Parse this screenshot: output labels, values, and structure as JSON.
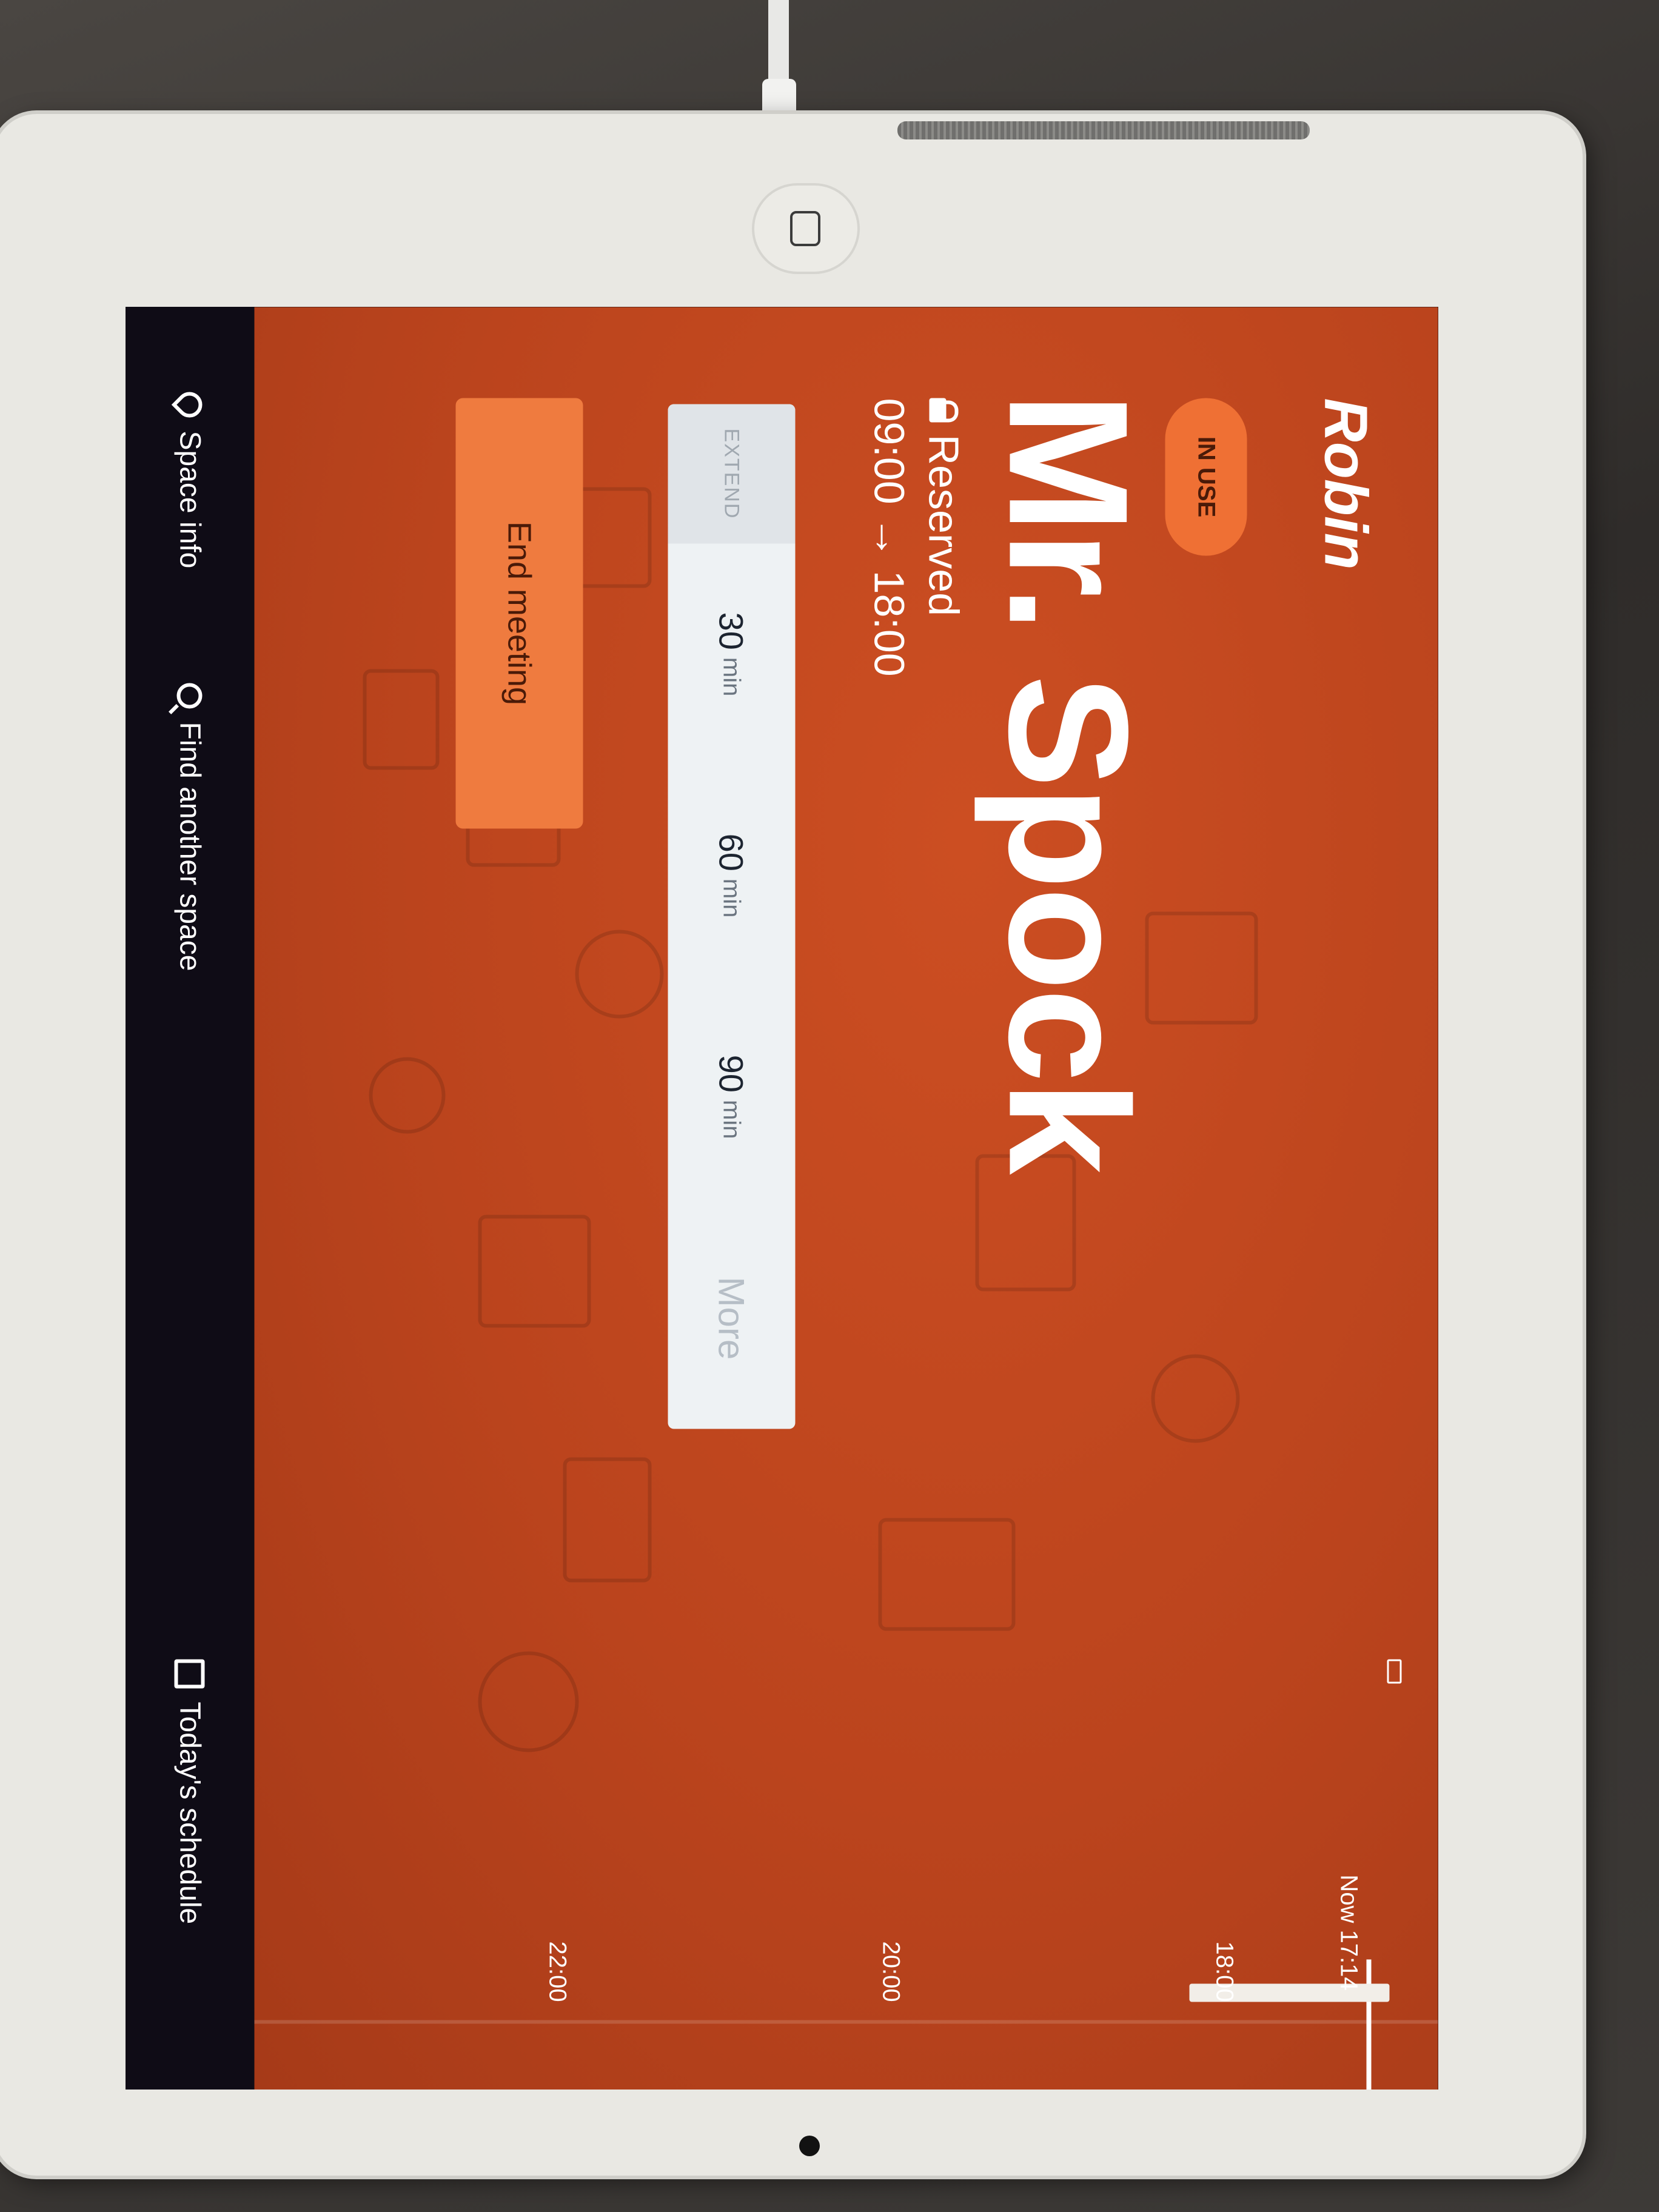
{
  "app": {
    "logo": "Robin"
  },
  "room": {
    "status": "IN USE",
    "name": "Mr. Spock",
    "reservation_state": "Reserved",
    "time_range": "09:00 → 18:00"
  },
  "extend": {
    "label": "EXTEND",
    "options": [
      {
        "value": "30",
        "unit": "min"
      },
      {
        "value": "60",
        "unit": "min"
      },
      {
        "value": "90",
        "unit": "min"
      }
    ],
    "more_label": "More"
  },
  "actions": {
    "end_meeting": "End meeting"
  },
  "timeline": {
    "now_label": "Now 17:14",
    "ticks": [
      "18:00",
      "20:00",
      "22:00"
    ]
  },
  "bottom_nav": {
    "space_info": "Space info",
    "find_space": "Find another space",
    "schedule": "Today's schedule"
  },
  "colors": {
    "background_accent": "#c84a20",
    "badge": "#ef7034",
    "end_button": "#ef7b3f",
    "nav_bar": "#0f0c16"
  }
}
